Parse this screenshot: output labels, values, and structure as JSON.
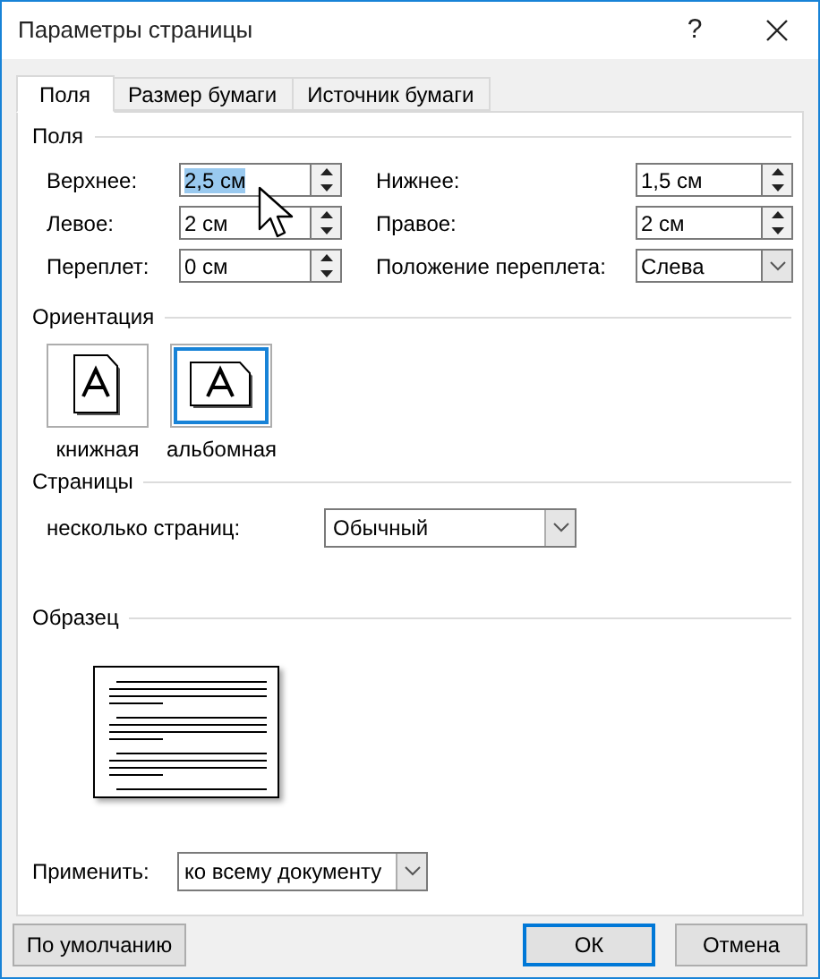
{
  "window": {
    "title": "Параметры страницы",
    "help": "?"
  },
  "tabs": [
    {
      "label": "Поля",
      "selected": true
    },
    {
      "label": "Размер бумаги",
      "selected": false
    },
    {
      "label": "Источник бумаги",
      "selected": false
    }
  ],
  "margins": {
    "title": "Поля",
    "fields": [
      {
        "label": "Верхнее:",
        "value": "2,5 см",
        "kind": "spin",
        "highlighted": true
      },
      {
        "label": "Нижнее:",
        "value": "1,5 см",
        "kind": "spin",
        "highlighted": false
      },
      {
        "label": "Левое:",
        "value": "2 см",
        "kind": "spin",
        "highlighted": false
      },
      {
        "label": "Правое:",
        "value": "2 см",
        "kind": "spin",
        "highlighted": false
      },
      {
        "label": "Переплет:",
        "value": "0 см",
        "kind": "spin",
        "highlighted": false
      },
      {
        "label": "Положение переплета:",
        "value": "Слева",
        "kind": "dropdown",
        "highlighted": false
      }
    ]
  },
  "orientation": {
    "title": "Ориентация",
    "options": [
      {
        "label": "книжная",
        "kind": "portrait",
        "selected": false
      },
      {
        "label": "альбомная",
        "kind": "landscape",
        "selected": true
      }
    ]
  },
  "pages": {
    "title": "Страницы",
    "label": "несколько страниц:",
    "value": "Обычный"
  },
  "sample": {
    "title": "Образец"
  },
  "apply": {
    "label": "Применить:",
    "value": "ко всему документу"
  },
  "buttons": [
    {
      "label": "По умолчанию",
      "default": false
    },
    {
      "label": "ОК",
      "default": true
    },
    {
      "label": "Отмена",
      "default": false
    }
  ]
}
